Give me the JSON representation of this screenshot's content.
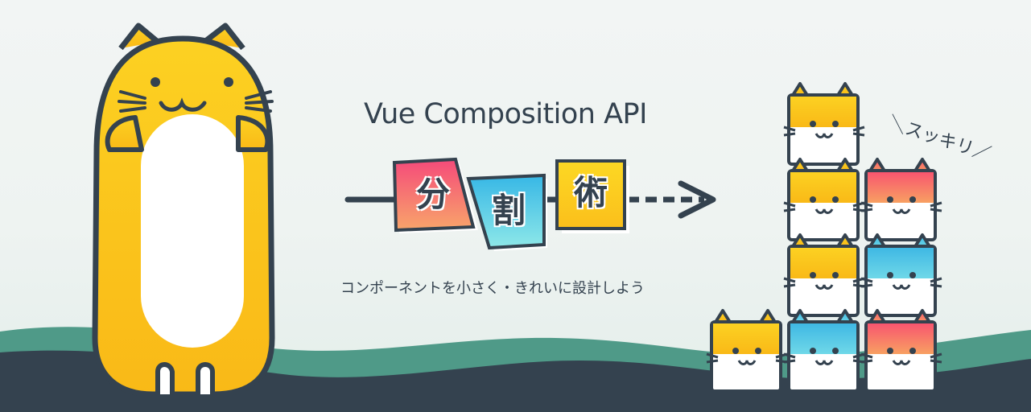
{
  "banner": {
    "title": "Vue Composition API",
    "subtitle": "コンポーネントを小さく・きれいに設計しよう",
    "tiles": [
      "分",
      "割",
      "術"
    ],
    "exclamation": "＼スッキリ／"
  },
  "colors": {
    "ink": "#34424f",
    "yellow": "#fcd122",
    "pink": "#f46a78",
    "cyan": "#45c4e4",
    "wave_teal": "#4f9a88",
    "wave_dark": "#34424f"
  },
  "icons": [
    "big-yellow-cat-illustration",
    "small-cat-block-icon",
    "arrow-icon"
  ]
}
